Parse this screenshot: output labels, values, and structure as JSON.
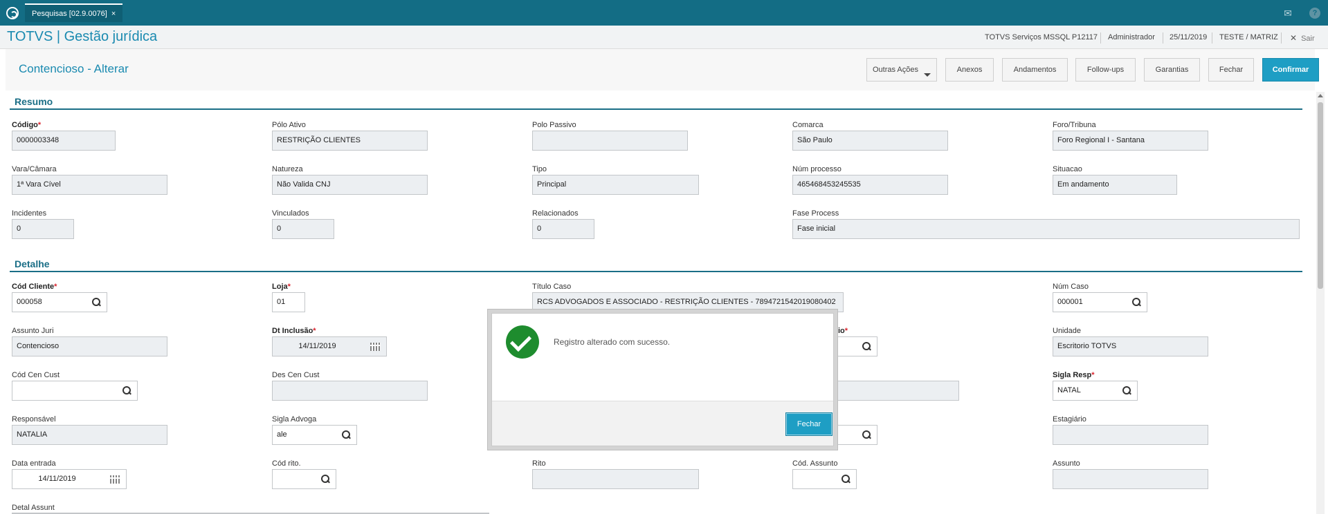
{
  "topbar": {
    "tab_label": "Pesquisas [02.9.0076]",
    "tab_close": "×",
    "mail_icon": "mail-icon",
    "help_icon": "help-icon"
  },
  "appbar": {
    "title": "TOTVS | Gestão jurídica",
    "env": "TOTVS Serviços MSSQL P12117",
    "user": "Administrador",
    "date": "25/11/2019",
    "company": "TESTE / MATRIZ",
    "exit": "Sair",
    "exit_glyph": "✕"
  },
  "form": {
    "title": "Contencioso - Alterar"
  },
  "toolbar": {
    "outras": "Outras Ações",
    "anexos": "Anexos",
    "andamentos": "Andamentos",
    "followups": "Follow-ups",
    "garantias": "Garantias",
    "fechar": "Fechar",
    "confirmar": "Confirmar"
  },
  "resumo": {
    "section": "Resumo",
    "codigo_label": "Código",
    "codigo": "0000003348",
    "polo_ativo_label": "Pólo Ativo",
    "polo_ativo": "RESTRIÇÃO CLIENTES",
    "polo_passivo_label": "Polo Passivo",
    "polo_passivo": "",
    "comarca_label": "Comarca",
    "comarca": "São Paulo",
    "foro_label": "Foro/Tribuna",
    "foro": "Foro Regional I - Santana",
    "vara_label": "Vara/Câmara",
    "vara": "1ª Vara Cível",
    "natureza_label": "Natureza",
    "natureza": "Não Valida CNJ",
    "tipo_label": "Tipo",
    "tipo": "Principal",
    "num_processo_label": "Núm processo",
    "num_processo": "465468453245535",
    "situacao_label": "Situacao",
    "situacao": "Em andamento",
    "incidentes_label": "Incidentes",
    "incidentes": "0",
    "vinculados_label": "Vinculados",
    "vinculados": "0",
    "relacionados_label": "Relacionados",
    "relacionados": "0",
    "fase_label": "Fase Process",
    "fase": "Fase inicial"
  },
  "detalhe": {
    "section": "Detalhe",
    "cod_cliente_label": "Cód Cliente",
    "cod_cliente": "000058",
    "loja_label": "Loja",
    "loja": "01",
    "titulo_caso_label": "Título Caso",
    "titulo_caso": "RCS ADVOGADOS E ASSOCIADO - RESTRIÇÃO CLIENTES - 7894721542019080402",
    "num_caso_label": "Núm Caso",
    "num_caso": "000001",
    "assunto_juri_label": "Assunto Juri",
    "assunto_juri": "Contencioso",
    "dt_inclusao_label": "Dt Inclusão",
    "dt_inclusao": "14/11/2019",
    "hidden_label_fragment": "io",
    "unidade_label": "Unidade",
    "unidade": "Escritorio TOTVS",
    "cod_cen_cust_label": "Cód Cen Cust",
    "cod_cen_cust": "",
    "des_cen_cust_label": "Des Cen Cust",
    "des_cen_cust": "",
    "sigla_resp_label": "Sigla Resp",
    "sigla_resp": "NATAL",
    "responsavel_label": "Responsável",
    "responsavel": "NATALIA",
    "sigla_advoga_label": "Sigla Advoga",
    "sigla_advoga": "ale",
    "estagiario_label": "Estagiário",
    "estagiario": "",
    "data_entrada_label": "Data entrada",
    "data_entrada": "14/11/2019",
    "cod_rito_label": "Cód rito.",
    "cod_rito": "",
    "rito_label": "Rito",
    "rito": "",
    "cod_assunto_label": "Cód. Assunto",
    "cod_assunto": "",
    "assunto_label": "Assunto",
    "assunto": "",
    "detal_assunt_label": "Detal Assunt"
  },
  "dialog": {
    "message": "Registro alterado com sucesso.",
    "button": "Fechar"
  }
}
